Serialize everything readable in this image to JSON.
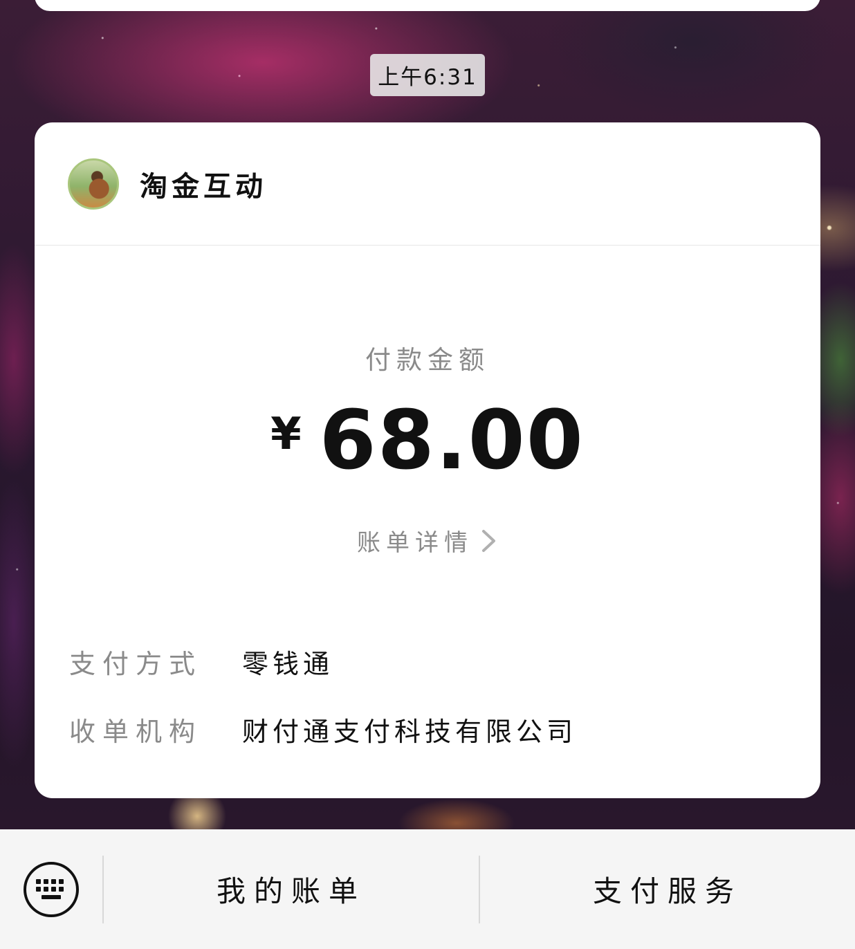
{
  "chat": {
    "timestamp": "上午6:31"
  },
  "card": {
    "merchant_name": "淘金互动",
    "amount_label": "付款金额",
    "currency_symbol": "¥",
    "amount": "68.00",
    "details_link": "账单详情",
    "rows": [
      {
        "key": "支付方式",
        "value": "零钱通"
      },
      {
        "key": "收单机构",
        "value": "财付通支付科技有限公司"
      }
    ]
  },
  "bottom_bar": {
    "keyboard_icon": "keyboard-icon",
    "menu_1": "我的账单",
    "menu_2": "支付服务"
  }
}
